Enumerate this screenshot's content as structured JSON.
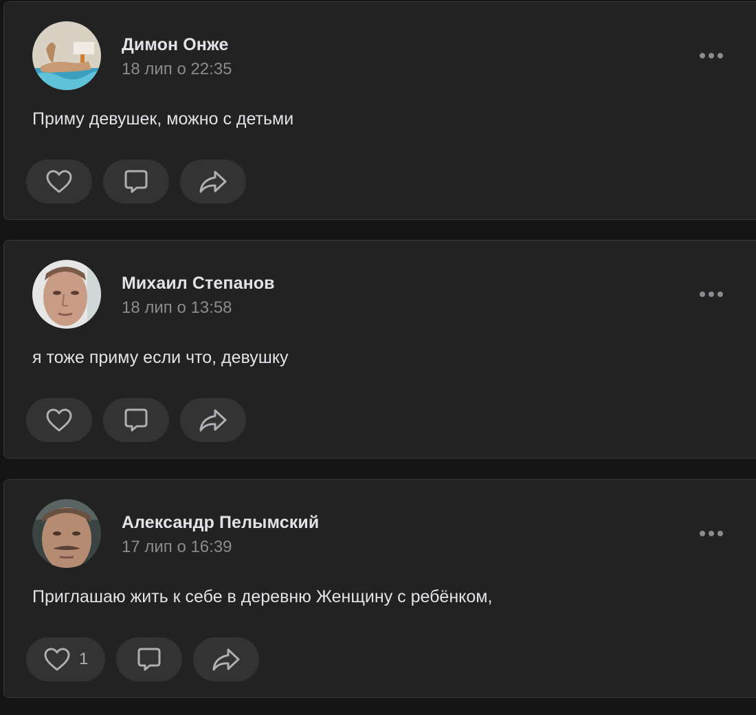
{
  "posts": [
    {
      "author": "Димон Онже",
      "time": "18 лип о 22:35",
      "text": "Приму девушек, можно с детьми",
      "like_count": "",
      "avatar_colors": [
        "#d9d2c4",
        "#c89a74",
        "#3a9fc0"
      ]
    },
    {
      "author": "Михаил Степанов",
      "time": "18 лип о 13:58",
      "text": "я тоже приму если что, девушку",
      "like_count": "",
      "avatar_colors": [
        "#e6e6e6",
        "#c99c86",
        "#7a5a48"
      ]
    },
    {
      "author": "Александр Пелымский",
      "time": "17 лип о 16:39",
      "text": "Приглашаю жить к себе в деревню Женщину с ребёнком,",
      "like_count": "1",
      "avatar_colors": [
        "#3a4442",
        "#b58c72",
        "#6a5040"
      ]
    }
  ],
  "icons": {
    "like": "heart-icon",
    "comment": "comment-icon",
    "share": "share-arrow-icon",
    "more": "more-dots-icon"
  },
  "colors": {
    "background": "#141414",
    "card": "#222222",
    "action_pill": "#333333",
    "text_primary": "#e1e3e6",
    "text_secondary": "#8a8c8f"
  }
}
